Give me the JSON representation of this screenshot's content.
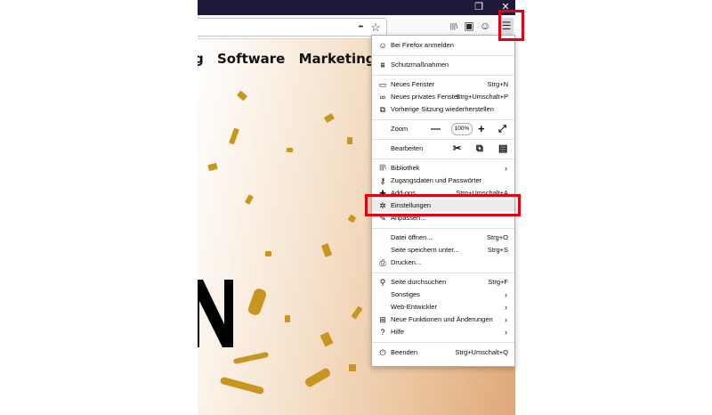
{
  "window": {
    "maximize_icon": "❐",
    "close_icon": "✕"
  },
  "toolbar": {
    "more_icon": "•••",
    "bookmark_icon": "☆",
    "library_icon": "|||\\",
    "sidebar_icon": "▣",
    "account_icon": "☺",
    "menu_icon": "☰"
  },
  "page": {
    "nav_items": [
      "g",
      "Software",
      "Marketing"
    ]
  },
  "menu": {
    "sign_in": "Bei Firefox anmelden",
    "protection": "Schutzmaßnahmen",
    "new_window": "Neues Fenster",
    "new_window_sc": "Strg+N",
    "new_private": "Neues privates Fenster",
    "new_private_sc": "Strg+Umschalt+P",
    "restore": "Vorherige Sitzung wiederherstellen",
    "zoom": "Zoom",
    "zoom_value": "100%",
    "zoom_minus": "—",
    "zoom_plus": "+",
    "edit": "Bearbeiten",
    "library": "Bibliothek",
    "logins": "Zugangsdaten und Passwörter",
    "addons": "Add-ons",
    "addons_sc": "Strg+Umschalt+A",
    "settings": "Einstellungen",
    "customize": "Anpassen...",
    "open_file": "Datei öffnen...",
    "open_file_sc": "Strg+O",
    "save_page": "Seite speichern unter...",
    "save_page_sc": "Strg+S",
    "print": "Drucken...",
    "find": "Seite durchsuchen",
    "find_sc": "Strg+F",
    "more": "Sonstiges",
    "webdev": "Web-Entwickler",
    "whats_new": "Neue Funktionen und Änderungen",
    "help": "Hilfe",
    "quit": "Beenden",
    "quit_sc": "Strg+Umschalt+Q",
    "arrow": "›"
  },
  "colors": {
    "highlight": "#e3000f",
    "titlebar": "#1f1a3a",
    "confetti": "#c8951f"
  }
}
